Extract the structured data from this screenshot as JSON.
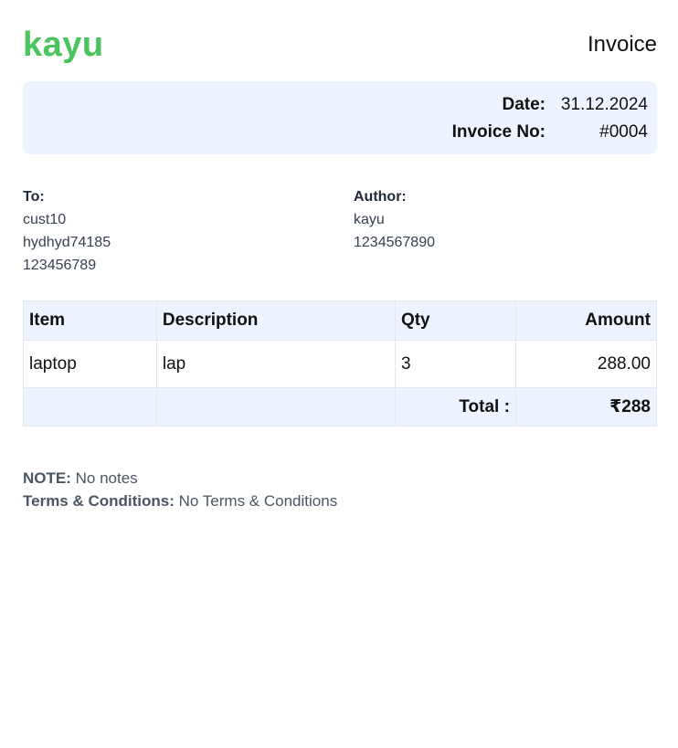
{
  "brand": {
    "name": "kayu",
    "color": "#4ac45d"
  },
  "document_title": "Invoice",
  "meta": {
    "date_label": "Date:",
    "date_value": "31.12.2024",
    "invoice_label": "Invoice No:",
    "invoice_value": "#0004",
    "background": "#eef4ff"
  },
  "to": {
    "title": "To:",
    "lines": [
      "cust10",
      "hydhyd74185",
      "123456789"
    ]
  },
  "author": {
    "title": "Author:",
    "lines": [
      "kayu",
      "1234567890"
    ]
  },
  "table": {
    "headers": {
      "item": "Item",
      "description": "Description",
      "qty": "Qty",
      "amount": "Amount"
    },
    "rows": [
      {
        "item": "laptop",
        "description": "lap",
        "qty": "3",
        "amount": "288.00"
      }
    ],
    "total_label": "Total :",
    "total_value": "₹288"
  },
  "notes": {
    "note_label": "NOTE:",
    "note_value": "No notes",
    "terms_label": "Terms & Conditions:",
    "terms_value": "No Terms & Conditions"
  }
}
